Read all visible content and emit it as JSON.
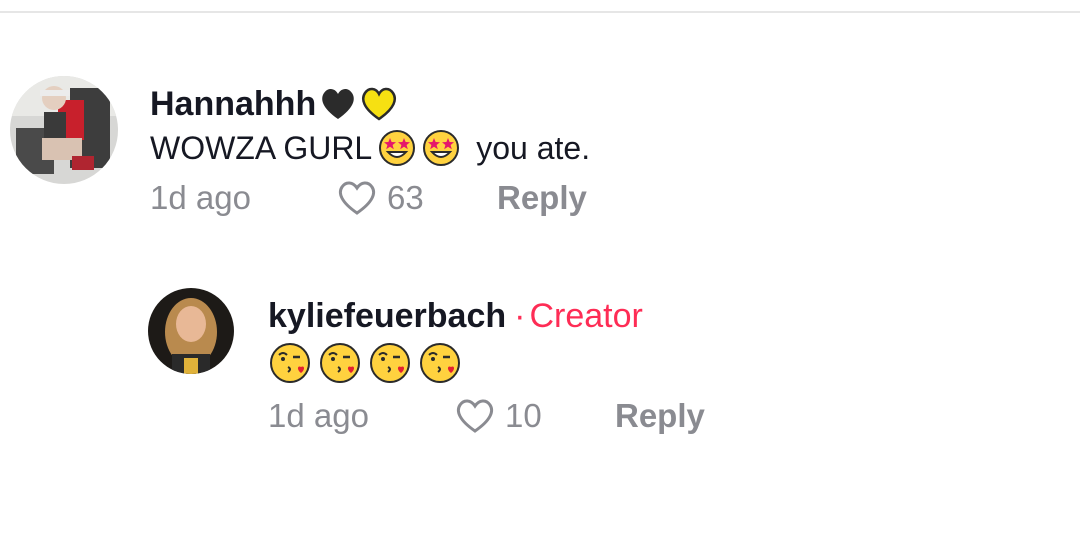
{
  "comments": [
    {
      "username": "Hannahhh",
      "username_emoji": [
        "black-heart",
        "yellow-heart"
      ],
      "text_before": "WOWZA GURL",
      "text_emoji": [
        "star-struck-face",
        "star-struck-face"
      ],
      "text_after": "you ate.",
      "time": "1d ago",
      "likes": "63",
      "reply_label": "Reply"
    }
  ],
  "reply": {
    "username": "kyliefeuerbach",
    "separator": "·",
    "badge": "Creator",
    "text_emoji": [
      "face-blowing-kiss",
      "face-blowing-kiss",
      "face-blowing-kiss",
      "face-blowing-kiss"
    ],
    "time": "1d ago",
    "likes": "10",
    "reply_label": "Reply"
  },
  "colors": {
    "creator": "#fe2c55",
    "meta": "#8a8b91",
    "text": "#161823",
    "divider": "#e6e6e6"
  }
}
